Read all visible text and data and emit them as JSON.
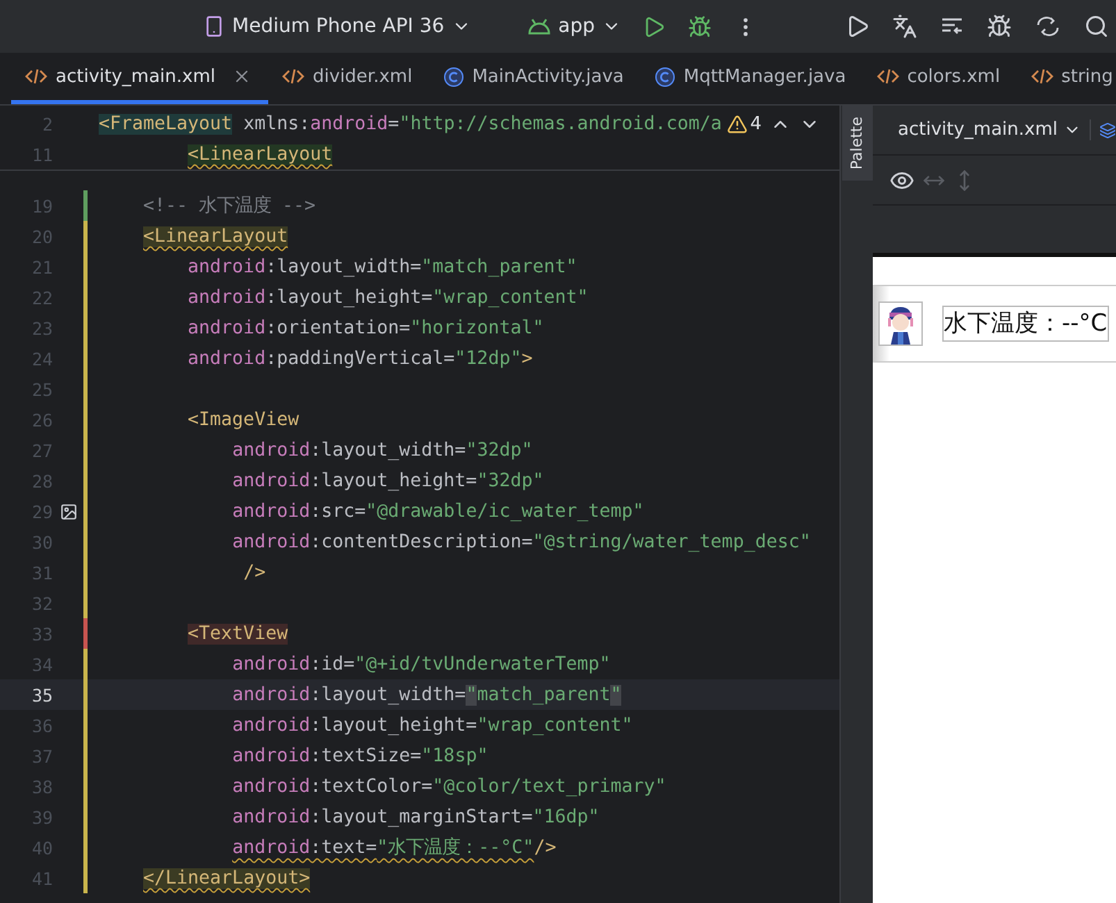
{
  "toolbar": {
    "device": "Medium Phone API 36",
    "config": "app"
  },
  "tabs": [
    {
      "label": "activity_main.xml",
      "kind": "xml",
      "selected": true
    },
    {
      "label": "divider.xml",
      "kind": "xml",
      "selected": false
    },
    {
      "label": "MainActivity.java",
      "kind": "java",
      "selected": false
    },
    {
      "label": "MqttManager.java",
      "kind": "java",
      "selected": false
    },
    {
      "label": "colors.xml",
      "kind": "xml",
      "selected": false
    },
    {
      "label": "string",
      "kind": "xml",
      "selected": false
    }
  ],
  "editor": {
    "warnings": "4",
    "sticky_lines": [
      {
        "number": "2",
        "tokens": [
          {
            "kind": "tag-scope",
            "text": "<FrameLayout"
          },
          {
            "kind": "plain",
            "text": " xmlns:"
          },
          {
            "kind": "ns",
            "text": "android"
          },
          {
            "kind": "plain",
            "text": "="
          },
          {
            "kind": "string",
            "text": "\"http://schemas.android.com/a"
          }
        ],
        "children": [
          {
            "number": "11",
            "tokens": [
              {
                "kind": "tag-inner",
                "text": "<LinearLayout"
              }
            ]
          }
        ]
      }
    ],
    "lines": [
      {
        "number": "19",
        "color": "#5f9e5f",
        "current": false,
        "tokens": [
          {
            "kind": "comment",
            "text": "<!-- 水下温度 -->"
          }
        ]
      },
      {
        "number": "20",
        "color": "#c9b44c",
        "current": false,
        "tokens": [
          {
            "kind": "tag-match",
            "text": "<LinearLayout"
          }
        ],
        "children": [
          {
            "number": "21",
            "color": "#c9b44c",
            "current": false,
            "tokens": [
              {
                "kind": "ns",
                "text": "android"
              },
              {
                "kind": "plain",
                "text": ":layout_width="
              },
              {
                "kind": "string",
                "text": "\"match_parent\""
              }
            ]
          },
          {
            "number": "22",
            "color": "#c9b44c",
            "current": false,
            "tokens": [
              {
                "kind": "ns",
                "text": "android"
              },
              {
                "kind": "plain",
                "text": ":layout_height="
              },
              {
                "kind": "string",
                "text": "\"wrap_content\""
              }
            ]
          },
          {
            "number": "23",
            "color": "#c9b44c",
            "current": false,
            "tokens": [
              {
                "kind": "ns",
                "text": "android"
              },
              {
                "kind": "plain",
                "text": ":orientation="
              },
              {
                "kind": "string",
                "text": "\"horizontal\""
              }
            ]
          },
          {
            "number": "24",
            "color": "#c9b44c",
            "current": false,
            "tokens": [
              {
                "kind": "ns",
                "text": "android"
              },
              {
                "kind": "plain",
                "text": ":paddingVertical="
              },
              {
                "kind": "string",
                "text": "\"12dp\""
              },
              {
                "kind": "tag",
                "text": ">"
              }
            ]
          },
          {
            "number": "25",
            "color": "#c9b44c",
            "current": false
          },
          {
            "number": "26",
            "color": "#c9b44c",
            "current": false,
            "tokens": [
              {
                "kind": "tag",
                "text": "<ImageView"
              }
            ],
            "children": [
              {
                "number": "27",
                "color": "#c9b44c",
                "current": false,
                "tokens": [
                  {
                    "kind": "ns",
                    "text": "android"
                  },
                  {
                    "kind": "plain",
                    "text": ":layout_width="
                  },
                  {
                    "kind": "string",
                    "text": "\"32dp\""
                  }
                ]
              },
              {
                "number": "28",
                "color": "#c9b44c",
                "current": false,
                "tokens": [
                  {
                    "kind": "ns",
                    "text": "android"
                  },
                  {
                    "kind": "plain",
                    "text": ":layout_height="
                  },
                  {
                    "kind": "string",
                    "text": "\"32dp\""
                  }
                ]
              },
              {
                "number": "29",
                "color": "#c9b44c",
                "current": false,
                "image_marker": true,
                "tokens": [
                  {
                    "kind": "ns",
                    "text": "android"
                  },
                  {
                    "kind": "plain",
                    "text": ":src="
                  },
                  {
                    "kind": "string",
                    "text": "\"@drawable/ic_water_temp\""
                  }
                ]
              },
              {
                "number": "30",
                "color": "#c9b44c",
                "current": false,
                "tokens": [
                  {
                    "kind": "ns",
                    "text": "android"
                  },
                  {
                    "kind": "plain",
                    "text": ":contentDescription="
                  },
                  {
                    "kind": "string",
                    "text": "\"@string/water_temp_desc\""
                  }
                ]
              },
              {
                "number": "31",
                "color": "#c9b44c",
                "current": false,
                "tokens": [
                  {
                    "kind": "tag",
                    "text": " />"
                  }
                ]
              }
            ]
          },
          {
            "number": "32",
            "color": "#c9b44c",
            "current": false
          },
          {
            "number": "33",
            "color": "#c75450",
            "current": false,
            "tokens": [
              {
                "kind": "tag-error",
                "text": "<TextView"
              }
            ],
            "children": [
              {
                "number": "34",
                "color": "#c9b44c",
                "current": false,
                "tokens": [
                  {
                    "kind": "ns",
                    "text": "android"
                  },
                  {
                    "kind": "plain",
                    "text": ":id="
                  },
                  {
                    "kind": "string",
                    "text": "\"@+id/tvUnderwaterTemp\""
                  }
                ]
              },
              {
                "number": "35",
                "color": "#c9b44c",
                "current": true,
                "tokens": [
                  {
                    "kind": "ns",
                    "text": "android"
                  },
                  {
                    "kind": "plain",
                    "text": ":layout_width="
                  },
                  {
                    "kind": "string-match",
                    "text": "\""
                  },
                  {
                    "kind": "string",
                    "text": "match_parent"
                  },
                  {
                    "kind": "string-match",
                    "text": "\""
                  }
                ]
              },
              {
                "number": "36",
                "color": "#c9b44c",
                "current": false,
                "tokens": [
                  {
                    "kind": "ns",
                    "text": "android"
                  },
                  {
                    "kind": "plain",
                    "text": ":layout_height="
                  },
                  {
                    "kind": "string",
                    "text": "\"wrap_content\""
                  }
                ]
              },
              {
                "number": "37",
                "color": "#c9b44c",
                "current": false,
                "tokens": [
                  {
                    "kind": "ns",
                    "text": "android"
                  },
                  {
                    "kind": "plain",
                    "text": ":textSize="
                  },
                  {
                    "kind": "string",
                    "text": "\"18sp\""
                  }
                ]
              },
              {
                "number": "38",
                "color": "#c9b44c",
                "current": false,
                "tokens": [
                  {
                    "kind": "ns",
                    "text": "android"
                  },
                  {
                    "kind": "plain",
                    "text": ":textColor="
                  },
                  {
                    "kind": "string",
                    "text": "\"@color/text_primary\""
                  }
                ]
              },
              {
                "number": "39",
                "color": "#c9b44c",
                "current": false,
                "tokens": [
                  {
                    "kind": "ns",
                    "text": "android"
                  },
                  {
                    "kind": "plain",
                    "text": ":layout_marginStart="
                  },
                  {
                    "kind": "string",
                    "text": "\"16dp\""
                  }
                ]
              },
              {
                "number": "40",
                "color": "#c9b44c",
                "current": false,
                "tokens": [
                  {
                    "kind": "ns-warn",
                    "text": "android"
                  },
                  {
                    "kind": "plain-warn",
                    "text": ":text="
                  },
                  {
                    "kind": "string-warn",
                    "text": "\"水下温度：--°C\""
                  },
                  {
                    "kind": "tag",
                    "text": "/>"
                  }
                ]
              }
            ]
          }
        ]
      },
      {
        "number": "41",
        "color": "#c9b44c",
        "current": false,
        "tokens": [
          {
            "kind": "tag-match",
            "text": "</LinearLayout>"
          }
        ]
      }
    ]
  },
  "palette": {
    "label": "Palette"
  },
  "design": {
    "file": "activity_main.xml",
    "preview_text": "水下温度：--°C"
  }
}
